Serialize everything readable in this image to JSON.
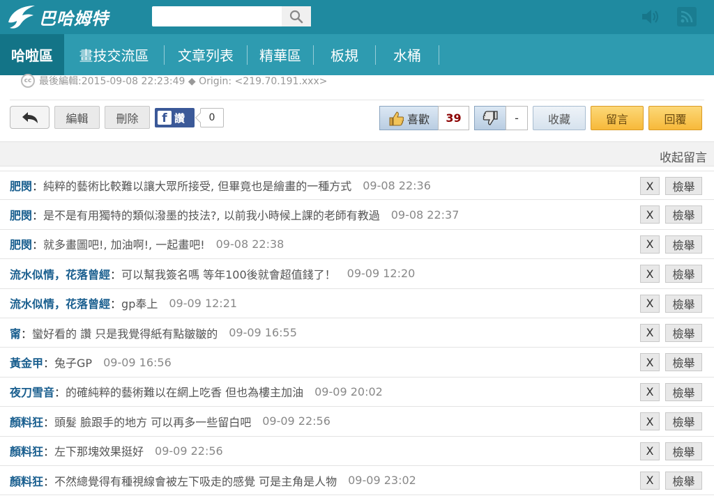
{
  "header": {
    "logo_text": "巴哈姆特",
    "search_placeholder": ""
  },
  "nav": {
    "items": [
      {
        "label": "哈啦區",
        "active": true
      },
      {
        "label": "畫技交流區"
      },
      {
        "label": "文章列表"
      },
      {
        "label": "精華區"
      },
      {
        "label": "板規"
      },
      {
        "label": "水桶"
      }
    ]
  },
  "meta": {
    "cc_label": "cc",
    "text": "最後編輯:2015-09-08 22:23:49 ◆ Origin: <219.70.191.xxx>"
  },
  "actions": {
    "edit_label": "編輯",
    "delete_label": "刪除",
    "fb_like_label": "讚",
    "fb_count": "0",
    "like_label": "喜歡",
    "like_count": "39",
    "dislike_count": "-",
    "favorite_label": "收藏",
    "comment_label": "留言",
    "reply_label": "回覆"
  },
  "comments_section": {
    "collapse_label": "收起留言",
    "delete_label": "X",
    "report_label": "檢舉",
    "items": [
      {
        "name": "肥閔",
        "text": "純粹的藝術比較難以讓大眾所接受, 但畢竟也是繪畫的一種方式",
        "time": "09-08 22:36"
      },
      {
        "name": "肥閔",
        "text": "是不是有用獨特的類似潑墨的技法?, 以前我小時候上課的老師有教過",
        "time": "09-08 22:37"
      },
      {
        "name": "肥閔",
        "text": "就多畫圖吧!, 加油啊!, 一起畫吧!",
        "time": "09-08 22:38"
      },
      {
        "name": "流水似情，花落曾經",
        "text": "可以幫我簽名嗎 等年100後就會超值錢了！",
        "time": "09-09 12:20"
      },
      {
        "name": "流水似情，花落曾經",
        "text": "gp奉上",
        "time": "09-09 12:21"
      },
      {
        "name": "甯",
        "text": "蠻好看的 讚 只是我覺得紙有點皺皺的",
        "time": "09-09 16:55"
      },
      {
        "name": "黃金甲",
        "text": "兔子GP",
        "time": "09-09 16:56"
      },
      {
        "name": "夜刀雪音",
        "text": "的確純粹的藝術難以在網上吃香 但也為樓主加油",
        "time": "09-09 20:02"
      },
      {
        "name": "顏料狂",
        "text": "頭髮 臉跟手的地方 可以再多一些留白吧",
        "time": "09-09 22:56"
      },
      {
        "name": "顏料狂",
        "text": "左下那塊效果挺好",
        "time": "09-09 22:56"
      },
      {
        "name": "顏料狂",
        "text": "不然總覺得有種視線會被左下吸走的感覺 可是主角是人物",
        "time": "09-09 23:02"
      }
    ]
  }
}
